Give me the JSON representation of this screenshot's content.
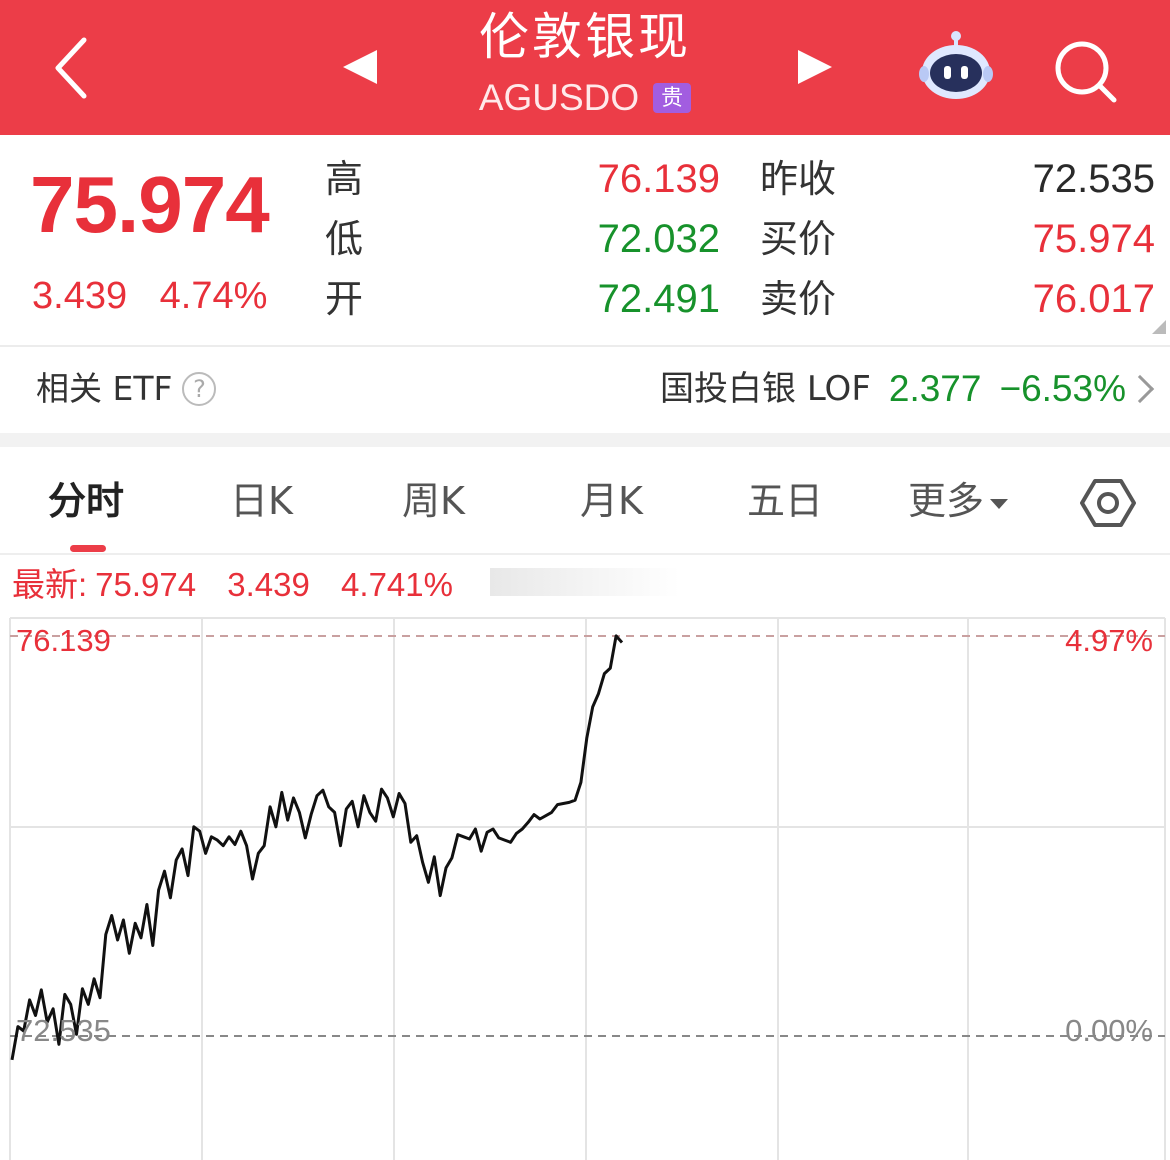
{
  "header": {
    "title": "伦敦银现",
    "code": "AGUSDO",
    "badge": "贵",
    "bg_color": "#ec3d48"
  },
  "icons": {
    "back": "chevron-left-icon",
    "prev": "triangle-left-icon",
    "next": "triangle-right-icon",
    "assistant": "robot-icon",
    "search": "search-icon",
    "settings": "hexagon-settings-icon",
    "help": "question-circle-icon"
  },
  "quote": {
    "last": "75.974",
    "change": "3.439",
    "change_pct": "4.74%",
    "high_label": "高",
    "high": "76.139",
    "low_label": "低",
    "low": "72.032",
    "open_label": "开",
    "open": "72.491",
    "prev_close_label": "昨收",
    "prev_close": "72.535",
    "bid_label": "买价",
    "bid": "75.974",
    "ask_label": "卖价",
    "ask": "76.017"
  },
  "etf": {
    "label": "相关 ETF",
    "help": "?",
    "name": "国投白银 LOF",
    "price": "2.377",
    "change_pct": "−6.53%"
  },
  "tabs": [
    {
      "label": "分时",
      "active": true
    },
    {
      "label": "日K"
    },
    {
      "label": "周K"
    },
    {
      "label": "月K"
    },
    {
      "label": "五日"
    },
    {
      "label": "更多"
    }
  ],
  "legend": {
    "latest_label": "最新:",
    "latest": "75.974",
    "change": "3.439",
    "change_pct": "4.741%"
  },
  "chart_data": {
    "type": "line",
    "ylim": [
      72.535,
      76.139
    ],
    "y_left_top_label": "76.139",
    "y_left_base_label": "72.535",
    "y_right_top_label": "4.97%",
    "y_right_base_label": "0.00%",
    "grid": true,
    "x": [
      0,
      1,
      2,
      3,
      4,
      5,
      6,
      7,
      8,
      9,
      10,
      11,
      12,
      13,
      14,
      15,
      16,
      17,
      18,
      19,
      20,
      21,
      22,
      23,
      24,
      25,
      26,
      27,
      28,
      29,
      30,
      31,
      32,
      33,
      34,
      35,
      36,
      37,
      38,
      39,
      40,
      41,
      42,
      43,
      44,
      45,
      46,
      47,
      48,
      49,
      50,
      51,
      52,
      53,
      54,
      55,
      56,
      57,
      58,
      59,
      60,
      61,
      62,
      63,
      64,
      65,
      66,
      67,
      68,
      69,
      70,
      71,
      72,
      73,
      74,
      75,
      76,
      77,
      78,
      79,
      80,
      81,
      82,
      83,
      84,
      85,
      86,
      87,
      88,
      89,
      90,
      91,
      92,
      93,
      94,
      95,
      96,
      97,
      98,
      99,
      100,
      101,
      102,
      103,
      104,
      105,
      106,
      107,
      108,
      109,
      110,
      111,
      112,
      113,
      114,
      115,
      116,
      117,
      118,
      119,
      120,
      121,
      122,
      123,
      124,
      125,
      126,
      127,
      128,
      129,
      130,
      131,
      132,
      133,
      134,
      135,
      136,
      137,
      138,
      139,
      140,
      141,
      142,
      143,
      144,
      145,
      146,
      147,
      148,
      149,
      150,
      151,
      152
    ],
    "series": [
      {
        "values": [
          72.32,
          72.62,
          72.58,
          72.86,
          72.72,
          72.95,
          72.66,
          72.78,
          72.46,
          72.91,
          72.82,
          72.55,
          72.96,
          72.82,
          73.05,
          72.88,
          73.45,
          73.62,
          73.4,
          73.58,
          73.28,
          73.55,
          73.42,
          73.72,
          73.35,
          73.85,
          74.02,
          73.78,
          74.12,
          74.22,
          73.98,
          74.42,
          74.38,
          74.18,
          74.33,
          74.3,
          74.25,
          74.33,
          74.26,
          74.38,
          74.25,
          73.95,
          74.18,
          74.25,
          74.6,
          74.42,
          74.73,
          74.48,
          74.68,
          74.55,
          74.32,
          74.53,
          74.7,
          74.75,
          74.6,
          74.55,
          74.25,
          74.58,
          74.65,
          74.42,
          74.7,
          74.55,
          74.47,
          74.76,
          74.68,
          74.51,
          74.72,
          74.63,
          74.28,
          74.34,
          74.1,
          73.92,
          74.15,
          73.8,
          74.05,
          74.14,
          74.35,
          74.33,
          74.31,
          74.4,
          74.2,
          74.37,
          74.4,
          74.32,
          74.3,
          74.28,
          74.36,
          74.4,
          74.46,
          74.53,
          74.49,
          74.52,
          74.55,
          74.62,
          74.63,
          74.64,
          74.66,
          74.82,
          75.22,
          75.5,
          75.62,
          75.8,
          75.85,
          76.14,
          76.08
        ],
        "color": "#111111"
      }
    ]
  }
}
